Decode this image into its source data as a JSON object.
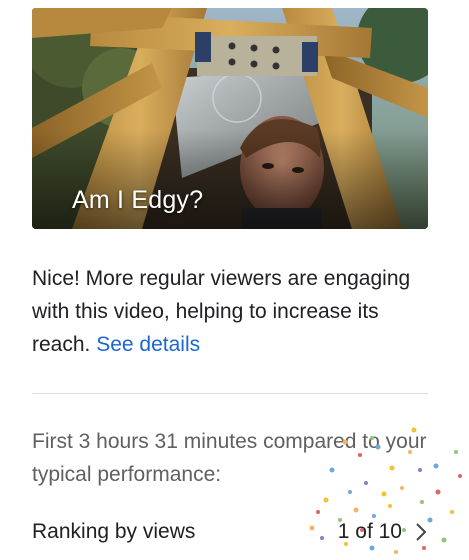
{
  "video": {
    "title": "Am I Edgy?"
  },
  "insight": {
    "message": "Nice! More regular viewers are engaging with this video, helping to increase its reach.",
    "link_label": "See details"
  },
  "comparison": {
    "description": "First 3 hours 31 minutes compared to your typical performance:"
  },
  "ranking": {
    "label": "Ranking by views",
    "value": "1 of 10",
    "icon": "chevron-right-icon"
  },
  "colors": {
    "link": "#1967d2",
    "text_primary": "#202124",
    "text_secondary": "#606060",
    "divider": "#dadce0"
  }
}
